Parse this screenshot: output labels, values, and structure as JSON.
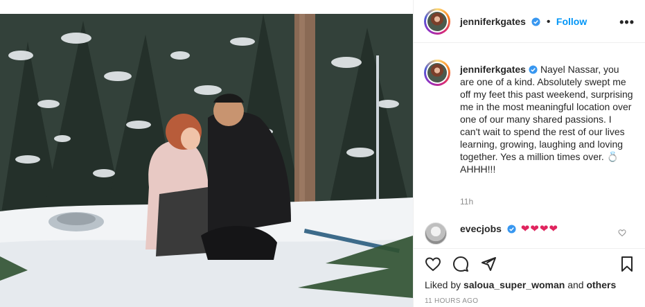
{
  "post": {
    "author": "jenniferkgates",
    "follow_label": "Follow",
    "dot": "•",
    "more_label": "•••"
  },
  "caption": {
    "author": "jenniferkgates",
    "text": "Nayel Nassar, you are one of a kind. Absolutely swept me off my feet this past weekend, surprising me in the most meaningful location over one of our many shared passions. I can't wait to spend the rest of our lives learning, growing, laughing and loving together. Yes a million times over. 💍 AHHH!!!",
    "age": "11h"
  },
  "comment": {
    "author": "evecjobs",
    "text": "❤❤❤❤"
  },
  "footer": {
    "liked_by_prefix": "Liked by",
    "liked_by_user": "saloua_super_woman",
    "liked_by_and": "and",
    "liked_by_others": "others",
    "timestamp": "11 HOURS AGO"
  },
  "colors": {
    "accent": "#0095f6",
    "text": "#262626",
    "muted": "#8e8e8e",
    "heart": "#e0245e"
  },
  "icons": {
    "verified": "verified-badge-icon",
    "like": "heart-icon",
    "comment": "comment-bubble-icon",
    "share": "paper-plane-icon",
    "save": "bookmark-icon",
    "more": "more-options-icon"
  }
}
